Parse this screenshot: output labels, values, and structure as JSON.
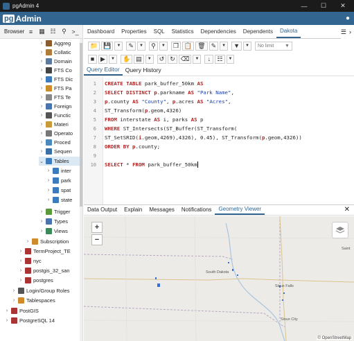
{
  "window": {
    "title": "pgAdmin 4",
    "min": "—",
    "max": "☐",
    "close": "✕"
  },
  "header": {
    "logo_pg": "pg",
    "logo_text": "Admin"
  },
  "left": {
    "browser_label": "Browser",
    "tree": [
      {
        "label": "Aggreg",
        "color": "#8a5c2e"
      },
      {
        "label": "Collatic",
        "color": "#b07c3a"
      },
      {
        "label": "Domain",
        "color": "#5a7aa0"
      },
      {
        "label": "FTS Co",
        "color": "#444"
      },
      {
        "label": "FTS Dic",
        "color": "#3c7bbd"
      },
      {
        "label": "FTS Pa",
        "color": "#cc8d2c"
      },
      {
        "label": "FTS Te",
        "color": "#888"
      },
      {
        "label": "Foreign",
        "color": "#4a74b0"
      },
      {
        "label": "Functic",
        "color": "#555"
      },
      {
        "label": "Materi",
        "color": "#c89a3a"
      },
      {
        "label": "Operato",
        "color": "#777"
      },
      {
        "label": "Proced",
        "color": "#4a8abf"
      },
      {
        "label": "Sequen",
        "color": "#3a6fa8"
      },
      {
        "label": "Tables",
        "color": "#3c7bbd"
      },
      {
        "label": "inter",
        "color": "#3c7bbd"
      },
      {
        "label": "park",
        "color": "#3c7bbd"
      },
      {
        "label": "spat",
        "color": "#3c7bbd"
      },
      {
        "label": "state",
        "color": "#3c7bbd"
      },
      {
        "label": "Trigger",
        "color": "#5a9a3a"
      },
      {
        "label": "Types",
        "color": "#4a74b0"
      },
      {
        "label": "Views",
        "color": "#3a8a5a"
      },
      {
        "label": "Subscription",
        "color": "#d08a2a"
      },
      {
        "label": "TermProject_TE",
        "color": "#a33"
      },
      {
        "label": "nyc",
        "color": "#a33"
      },
      {
        "label": "postgis_32_san",
        "color": "#a33"
      },
      {
        "label": "postgres",
        "color": "#a33"
      },
      {
        "label": "Login/Group Roles",
        "color": "#555"
      },
      {
        "label": "Tablespaces",
        "color": "#d08a2a"
      },
      {
        "label": "PostGIS",
        "color": "#a33"
      },
      {
        "label": "PostgreSQL 14",
        "color": "#a33"
      }
    ],
    "fts_pa_prefix": "Aa",
    "sequence_prefix": "1.3"
  },
  "tabs": [
    "Dashboard",
    "Properties",
    "SQL",
    "Statistics",
    "Dependencies",
    "Dependents",
    "Dakota"
  ],
  "active_tab": "Dakota",
  "query_toolbar": {
    "limit_label": "No limit"
  },
  "query_tabs": [
    "Query Editor",
    "Query History"
  ],
  "editor": {
    "line_numbers": [
      "1",
      "2",
      "3",
      "4",
      "5",
      "6",
      "7",
      "8",
      "9",
      "10"
    ],
    "l1_kw": "CREATE TABLE",
    "l1_a": " park_buffer_50km ",
    "l1_kw2": "AS",
    "l2_kw": "SELECT DISTINCT",
    "l2_a": " p",
    "l2_b": ".parkname ",
    "l2_kw2": "AS",
    "l2_str": " \"Park Name\"",
    "l3_a": "p",
    "l3_b": ".county ",
    "l3_kw": "AS",
    "l3_str": " \"County\"",
    "l3_c": ", ",
    "l3_d": "p",
    "l3_e": ".acres ",
    "l3_kw2": "AS",
    "l3_str2": " \"Acres\"",
    "l4": "ST_Transform(",
    "l4_p": "p",
    "l4_b": ".geom,4326)",
    "l5_kw": "FROM",
    "l5_a": " interstate ",
    "l5_kw2": "AS",
    "l5_b": " i, parks ",
    "l5_kw3": "AS",
    "l5_c": " p",
    "l6_kw": "WHERE",
    "l6_a": " ST_Intersects(ST_Buffer(ST_Transform(",
    "l7_a": "ST_SetSRID(",
    "l7_i": "i",
    "l7_b": ".geom,4269),4326), 0.45), ST_Transform(",
    "l7_p": "p",
    "l7_c": ".geom,4326))",
    "l8_kw": "ORDER BY",
    "l8_p": " p",
    "l8_a": ".county;",
    "l10_kw": "SELECT",
    "l10_a": " * ",
    "l10_kw2": "FROM",
    "l10_b": " park_buffer_50km"
  },
  "output_tabs": [
    "Data Output",
    "Explain",
    "Messages",
    "Notifications",
    "Geometry Viewer"
  ],
  "active_output_tab": "Geometry Viewer",
  "map": {
    "zoom_in": "+",
    "zoom_out": "−",
    "labels": [
      "South Dakota",
      "Sioux Falls",
      "Sioux City",
      "Saint"
    ],
    "attribution": "© OpenStreetMap"
  }
}
